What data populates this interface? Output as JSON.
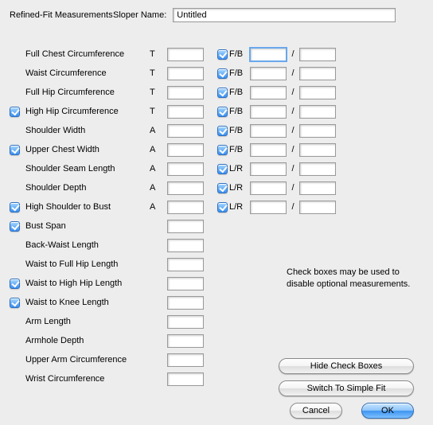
{
  "header": {
    "title": "Refined-Fit Measurements",
    "sloper_label": "Sloper Name:",
    "sloper_value": "Untitled"
  },
  "rows": [
    {
      "cb": null,
      "label": "Full Chest Circumference",
      "type": "T",
      "v1": "",
      "cb2": true,
      "fb": "F/B",
      "v2": "",
      "v3": ""
    },
    {
      "cb": null,
      "label": "Waist Circumference",
      "type": "T",
      "v1": "",
      "cb2": true,
      "fb": "F/B",
      "v2": "",
      "v3": ""
    },
    {
      "cb": null,
      "label": "Full Hip Circumference",
      "type": "T",
      "v1": "",
      "cb2": true,
      "fb": "F/B",
      "v2": "",
      "v3": ""
    },
    {
      "cb": true,
      "label": "High Hip Circumference",
      "type": "T",
      "v1": "",
      "cb2": true,
      "fb": "F/B",
      "v2": "",
      "v3": ""
    },
    {
      "cb": null,
      "label": "Shoulder Width",
      "type": "A",
      "v1": "",
      "cb2": true,
      "fb": "F/B",
      "v2": "",
      "v3": ""
    },
    {
      "cb": true,
      "label": "Upper Chest Width",
      "type": "A",
      "v1": "",
      "cb2": true,
      "fb": "F/B",
      "v2": "",
      "v3": ""
    },
    {
      "cb": null,
      "label": "Shoulder Seam Length",
      "type": "A",
      "v1": "",
      "cb2": true,
      "fb": "L/R",
      "v2": "",
      "v3": ""
    },
    {
      "cb": null,
      "label": "Shoulder Depth",
      "type": "A",
      "v1": "",
      "cb2": true,
      "fb": "L/R",
      "v2": "",
      "v3": ""
    },
    {
      "cb": true,
      "label": "High Shoulder to Bust",
      "type": "A",
      "v1": "",
      "cb2": true,
      "fb": "L/R",
      "v2": "",
      "v3": ""
    },
    {
      "cb": true,
      "label": "Bust Span",
      "type": "",
      "v1": "",
      "cb2": null,
      "fb": "",
      "v2": null,
      "v3": null
    },
    {
      "cb": null,
      "label": "Back-Waist Length",
      "type": "",
      "v1": "",
      "cb2": null,
      "fb": "",
      "v2": null,
      "v3": null
    },
    {
      "cb": null,
      "label": "Waist to Full Hip Length",
      "type": "",
      "v1": "",
      "cb2": null,
      "fb": "",
      "v2": null,
      "v3": null
    },
    {
      "cb": true,
      "label": "Waist to High Hip Length",
      "type": "",
      "v1": "",
      "cb2": null,
      "fb": "",
      "v2": null,
      "v3": null
    },
    {
      "cb": true,
      "label": "Waist to Knee Length",
      "type": "",
      "v1": "",
      "cb2": null,
      "fb": "",
      "v2": null,
      "v3": null
    },
    {
      "cb": null,
      "label": "Arm Length",
      "type": "",
      "v1": "",
      "cb2": null,
      "fb": "",
      "v2": null,
      "v3": null
    },
    {
      "cb": null,
      "label": "Armhole Depth",
      "type": "",
      "v1": "",
      "cb2": null,
      "fb": "",
      "v2": null,
      "v3": null
    },
    {
      "cb": null,
      "label": "Upper Arm Circumference",
      "type": "",
      "v1": "",
      "cb2": null,
      "fb": "",
      "v2": null,
      "v3": null
    },
    {
      "cb": null,
      "label": "Wrist Circumference",
      "type": "",
      "v1": "",
      "cb2": null,
      "fb": "",
      "v2": null,
      "v3": null
    }
  ],
  "hint": "Check boxes may be used to disable optional measurements.",
  "buttons": {
    "hide": "Hide Check Boxes",
    "switch": "Switch To Simple Fit",
    "cancel": "Cancel",
    "ok": "OK"
  }
}
